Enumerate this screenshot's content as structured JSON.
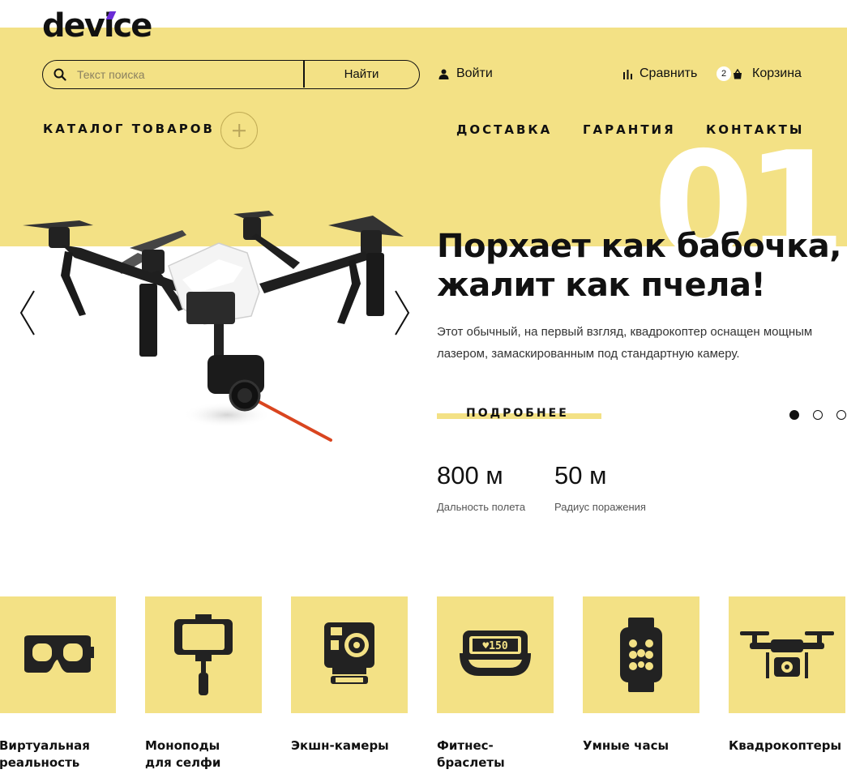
{
  "header": {
    "logo": "device",
    "search": {
      "placeholder": "Текст поиска",
      "button_label": "Найти"
    },
    "login_label": "Войти",
    "compare_label": "Сравнить",
    "cart_label": "Корзина",
    "cart_count": "2"
  },
  "nav": {
    "catalog_label": "КАТАЛОГ ТОВАРОВ",
    "items": [
      {
        "label": "ДОСТАВКА"
      },
      {
        "label": "ГАРАНТИЯ"
      },
      {
        "label": "КОНТАКТЫ"
      }
    ]
  },
  "slider": {
    "number": "01",
    "title": "Порхает как бабочка, жалит как пчела!",
    "description": "Этот обычный, на первый взгляд, квадрокоптер оснащен мощным лазером, замаскированным под стандартную камеру.",
    "more_label": "ПОДРОБНЕЕ",
    "active_slide": 1,
    "slide_count": 3,
    "stats": [
      {
        "value": "800 м",
        "label": "Дальность полета"
      },
      {
        "value": "50 м",
        "label": "Радиус поражения"
      }
    ]
  },
  "categories": [
    {
      "name": "Виртуальная\nреальность",
      "icon": "vr-headset-icon"
    },
    {
      "name": "Моноподы\nдля селфи",
      "icon": "selfie-stick-icon"
    },
    {
      "name": "Экшн-камеры",
      "icon": "action-camera-icon"
    },
    {
      "name": "Фитнес-браслеты",
      "icon": "fitness-band-icon",
      "display_text": "♥150"
    },
    {
      "name": "Умные часы",
      "icon": "smartwatch-icon"
    },
    {
      "name": "Квадрокоптеры",
      "icon": "quadcopter-icon"
    }
  ],
  "colors": {
    "accent_yellow": "#f3e185",
    "logo_accent": "#6a2bd6",
    "laser": "#d9451f"
  }
}
